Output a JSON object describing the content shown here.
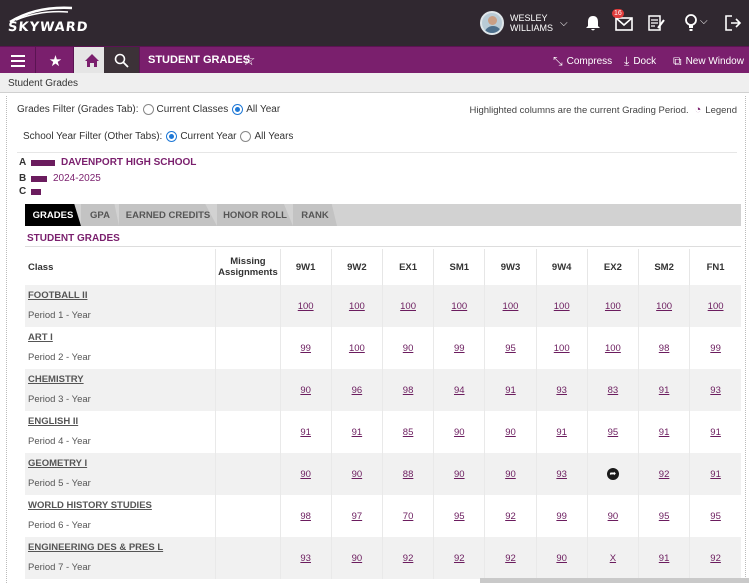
{
  "brand": {
    "logo_text": "SKYWARD"
  },
  "user": {
    "name_line1": "WESLEY",
    "name_line2": "WILLIAMS"
  },
  "topbar": {
    "message_count": "16"
  },
  "nav": {
    "title": "STUDENT GRADES",
    "compress": "Compress",
    "dock": "Dock",
    "new_window": "New Window"
  },
  "breadcrumb": "Student Grades",
  "filters": {
    "grades_filter_label": "Grades Filter (Grades Tab):",
    "grades_options": [
      "Current Classes",
      "All Year"
    ],
    "grades_selected": "All Year",
    "year_filter_label": "School Year Filter (Other Tabs):",
    "year_options": [
      "Current Year",
      "All Years"
    ],
    "year_selected": "Current Year"
  },
  "legend": {
    "note": "Highlighted columns are the current Grading Period.",
    "label": "Legend"
  },
  "school": {
    "letters": [
      "A",
      "B",
      "C"
    ],
    "name": "DAVENPORT HIGH SCHOOL",
    "year": "2024-2025"
  },
  "tabs": [
    "GRADES",
    "GPA",
    "EARNED CREDITS",
    "HONOR ROLL",
    "RANK"
  ],
  "active_tab": "GRADES",
  "section_title": "STUDENT GRADES",
  "table": {
    "col_class": "Class",
    "col_missing_1": "Missing",
    "col_missing_2": "Assignments",
    "periods": [
      "9W1",
      "9W2",
      "EX1",
      "SM1",
      "9W3",
      "9W4",
      "EX2",
      "SM2",
      "FN1"
    ],
    "rows": [
      {
        "name": "FOOTBALL II",
        "period": "Period 1 - Year",
        "grades": [
          "100",
          "100",
          "100",
          "100",
          "100",
          "100",
          "100",
          "100",
          "100"
        ]
      },
      {
        "name": "ART I",
        "period": "Period 2 - Year",
        "grades": [
          "99",
          "100",
          "90",
          "99",
          "95",
          "100",
          "100",
          "98",
          "99"
        ]
      },
      {
        "name": "CHEMISTRY",
        "period": "Period 3 - Year",
        "grades": [
          "90",
          "96",
          "98",
          "94",
          "91",
          "93",
          "83",
          "91",
          "93"
        ]
      },
      {
        "name": "ENGLISH II",
        "period": "Period 4 - Year",
        "grades": [
          "91",
          "91",
          "85",
          "90",
          "90",
          "91",
          "95",
          "91",
          "91"
        ]
      },
      {
        "name": "GEOMETRY I",
        "period": "Period 5 - Year",
        "grades": [
          "90",
          "90",
          "88",
          "90",
          "90",
          "93",
          "",
          "92",
          "91"
        ]
      },
      {
        "name": "WORLD HISTORY STUDIES",
        "period": "Period 6 - Year",
        "grades": [
          "98",
          "97",
          "70",
          "95",
          "92",
          "99",
          "90",
          "95",
          "95"
        ]
      },
      {
        "name": "ENGINEERING DES & PRES L",
        "period": "Period 7 - Year",
        "grades": [
          "93",
          "90",
          "92",
          "92",
          "92",
          "90",
          "X",
          "91",
          "92"
        ]
      }
    ]
  },
  "colors": {
    "brand_purple": "#7a1f6d",
    "topbar": "#302830",
    "active_tab": "#000000"
  }
}
